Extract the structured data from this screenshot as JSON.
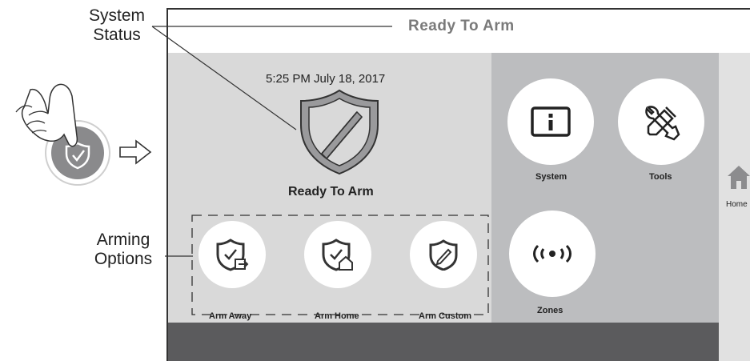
{
  "annotations": {
    "system_status": [
      "System",
      "Status"
    ],
    "arming_options": [
      "Arming",
      "Options"
    ]
  },
  "header": {
    "status": "Ready To Arm"
  },
  "home_panel": {
    "datetime": "5:25 PM July 18, 2017",
    "status": "Ready To Arm"
  },
  "arming": [
    {
      "label": "Arm Away",
      "icon": "arm-away-icon"
    },
    {
      "label": "Arm Home",
      "icon": "arm-home-icon"
    },
    {
      "label": "Arm Custom",
      "icon": "arm-custom-icon"
    }
  ],
  "menu": [
    {
      "label": "System",
      "icon": "info-icon"
    },
    {
      "label": "Tools",
      "icon": "tools-icon"
    },
    {
      "label": "Zones",
      "icon": "zones-icon"
    }
  ],
  "side": {
    "label": "Home",
    "icon": "home-icon"
  },
  "colors": {
    "left_panel": "#d9d9d9",
    "right_panel": "#bcbdbf",
    "bottom_bar": "#5b5b5d",
    "status_text": "#7a7a7a"
  }
}
